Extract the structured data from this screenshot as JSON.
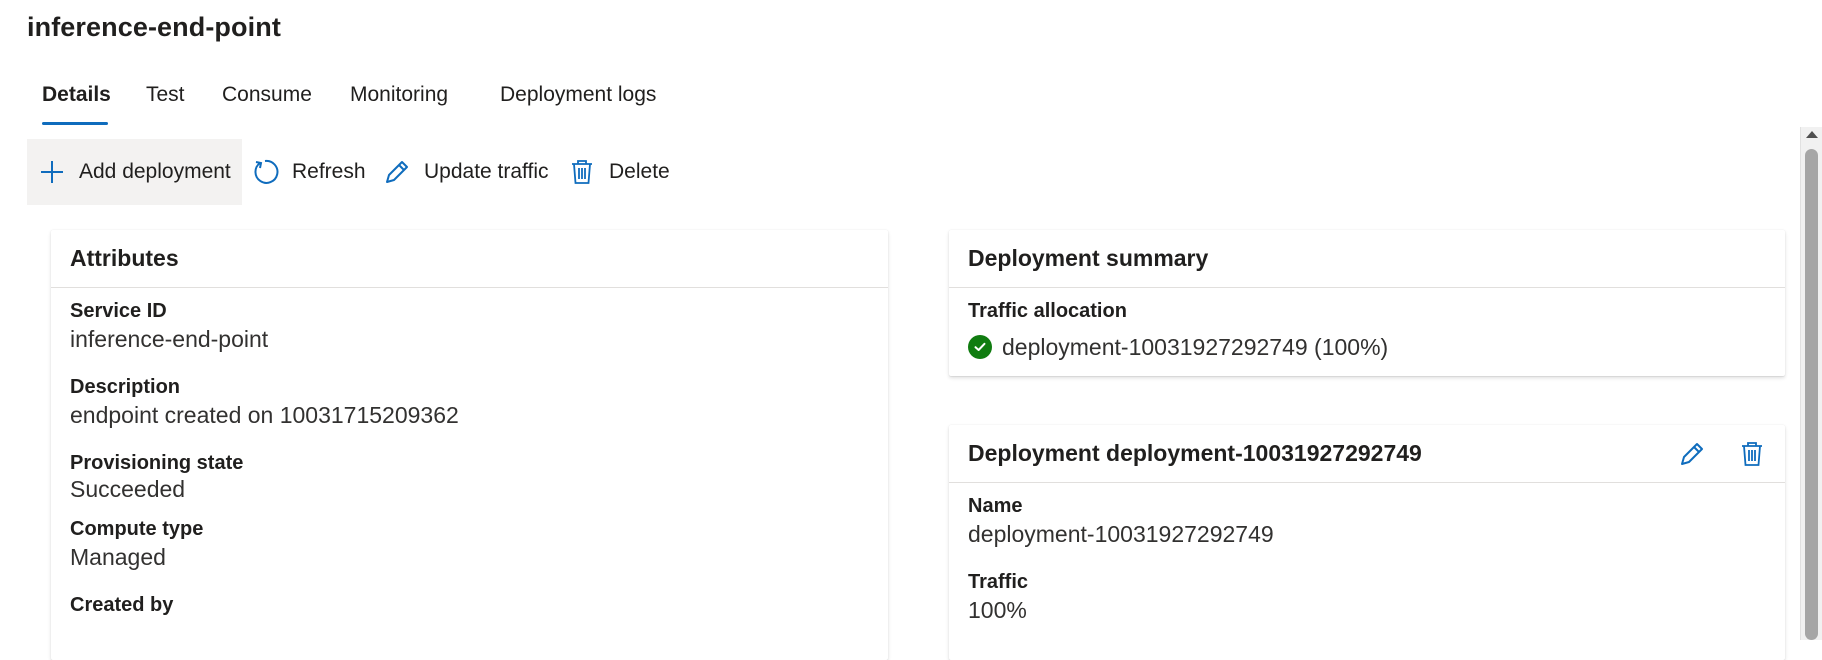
{
  "page": {
    "title": "inference-end-point"
  },
  "tabs": [
    {
      "label": "Details",
      "active": true
    },
    {
      "label": "Test"
    },
    {
      "label": "Consume"
    },
    {
      "label": "Monitoring"
    },
    {
      "label": "Deployment logs"
    }
  ],
  "toolbar": {
    "add_deployment": "Add deployment",
    "refresh": "Refresh",
    "update_traffic": "Update traffic",
    "delete": "Delete"
  },
  "attributes": {
    "title": "Attributes",
    "fields": [
      {
        "label": "Service ID",
        "value": "inference-end-point"
      },
      {
        "label": "Description",
        "value": "endpoint created on 10031715209362"
      },
      {
        "label": "Provisioning state",
        "value": "Succeeded"
      },
      {
        "label": "Compute type",
        "value": "Managed"
      },
      {
        "label": "Created by",
        "value": ""
      }
    ]
  },
  "summary": {
    "title": "Deployment summary",
    "traffic_label": "Traffic allocation",
    "traffic_value": "deployment-10031927292749 (100%)",
    "status": "success"
  },
  "deployment": {
    "title": "Deployment deployment-10031927292749",
    "fields": [
      {
        "label": "Name",
        "value": "deployment-10031927292749"
      },
      {
        "label": "Traffic",
        "value": "100%"
      }
    ]
  },
  "colors": {
    "accent": "#0f6cbd",
    "success": "#107c10",
    "text": "#201f1e"
  },
  "icons": [
    "add-icon",
    "refresh-icon",
    "edit-icon",
    "delete-icon",
    "check-circle-icon"
  ]
}
